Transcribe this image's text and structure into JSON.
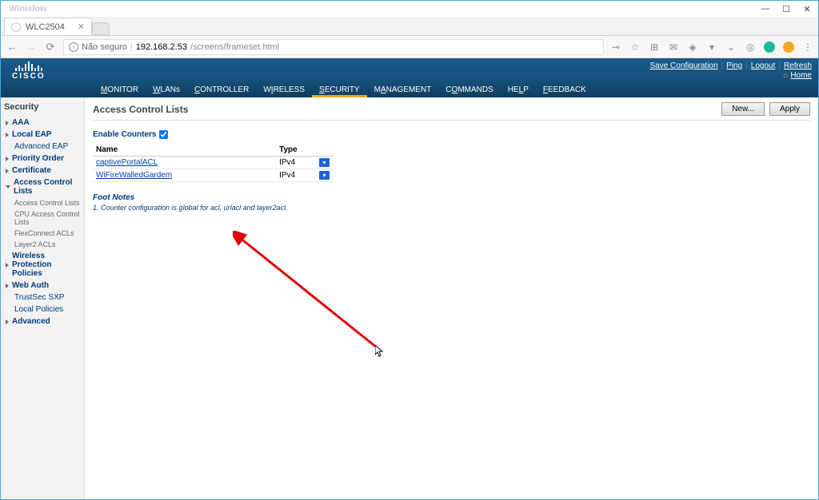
{
  "window": {
    "watermark": "Winislow",
    "minimize": "—",
    "maximize": "☐",
    "close": "✕"
  },
  "browser": {
    "tab_title": "WLC2504",
    "tab_close": "✕",
    "back": "←",
    "forward": "→",
    "reload": "⟳",
    "security_label": "Não seguro",
    "url_ip": "192.168.2.53",
    "url_path": "/screens/frameset.html",
    "key": "⊸",
    "star": "☆",
    "ext": "⊞",
    "mail": "✉",
    "diamond": "◈",
    "down": "▾",
    "pocket": "⌄",
    "menu": "⋮"
  },
  "cisco": {
    "brand": "CISCO",
    "top_links": {
      "save": "Save Configuration",
      "ping": "Ping",
      "logout": "Logout",
      "refresh": "Refresh"
    },
    "home": "Home",
    "nav": {
      "monitor": "MONITOR",
      "wlans": "WLANs",
      "controller": "CONTROLLER",
      "wireless": "WIRELESS",
      "security": "SECURITY",
      "management": "MANAGEMENT",
      "commands": "COMMANDS",
      "help": "HELP",
      "feedback": "FEEDBACK"
    }
  },
  "sidebar": {
    "title": "Security",
    "items": [
      {
        "label": "AAA"
      },
      {
        "label": "Local EAP"
      },
      {
        "label": "Advanced EAP",
        "plain": true
      },
      {
        "label": "Priority Order"
      },
      {
        "label": "Certificate"
      },
      {
        "label": "Access Control Lists",
        "open": true,
        "children": [
          "Access Control Lists",
          "CPU Access Control Lists",
          "FlexConnect ACLs",
          "Layer2 ACLs"
        ]
      },
      {
        "label": "Wireless Protection Policies"
      },
      {
        "label": "Web Auth"
      },
      {
        "label": "TrustSec SXP",
        "plain": true
      },
      {
        "label": "Local Policies",
        "plain": true
      },
      {
        "label": "Advanced"
      }
    ]
  },
  "page": {
    "title": "Access Control Lists",
    "btn_new": "New...",
    "btn_apply": "Apply",
    "enable_counters": "Enable Counters",
    "enable_counters_checked": true,
    "table": {
      "col_name": "Name",
      "col_type": "Type",
      "rows": [
        {
          "name": "captivePortalACL",
          "type": "IPv4"
        },
        {
          "name": "WiFireWalledGardem",
          "type": "IPv4"
        }
      ],
      "dropdown_glyph": "▾"
    },
    "footnotes_title": "Foot Notes",
    "footnote1": "1. Counter configuration is global for acl, urlacl and layer2acl."
  }
}
